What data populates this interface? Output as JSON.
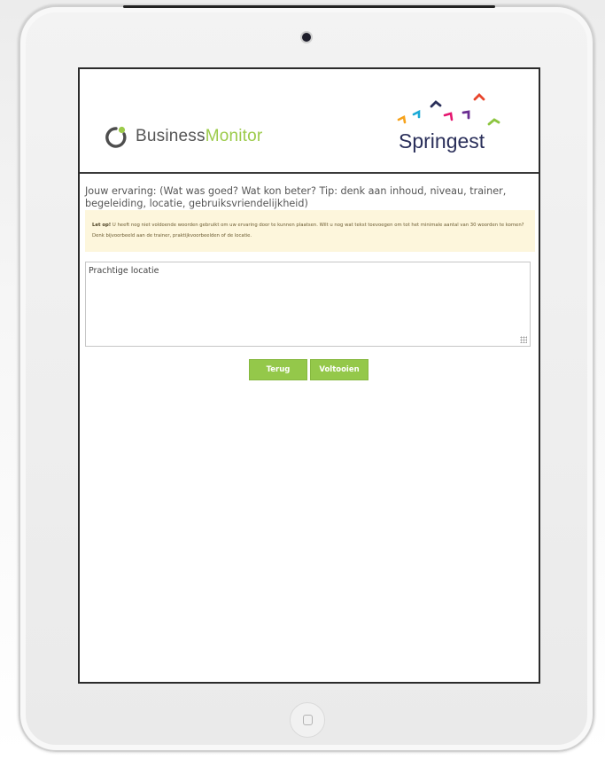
{
  "header": {
    "businessmonitor_logo": {
      "name_part1": "Business",
      "name_part2": "Monitor"
    },
    "springest_logo": {
      "name": "Springest"
    }
  },
  "form": {
    "question": "Jouw ervaring: (Wat was goed? Wat kon beter? Tip: denk aan inhoud, niveau, trainer, begeleiding, locatie, gebruiksvriendelijkheid)",
    "notice": {
      "label": "Let op!",
      "text": " U heeft nog niet voldoende woorden gebruikt om uw ervaring door te kunnen plaatsen. Wilt u nog wat tekst toevoegen om tot het minimale aantal van 30 woorden te komen? Denk bijvoorbeeld aan de trainer, praktijkvoorbeelden of de locatie."
    },
    "answer_value": "Prachtige locatie",
    "buttons": {
      "back_label": "Terug",
      "finish_label": "Voltooien"
    }
  },
  "colors": {
    "accent_green": "#94c84a",
    "notice_bg": "#fdf6dc",
    "springest_navy": "#2a2f5a"
  },
  "icons": [
    "businessmonitor-ring-icon",
    "springest-arrows-icon",
    "resize-grip-icon",
    "home-button-icon",
    "camera-icon"
  ]
}
